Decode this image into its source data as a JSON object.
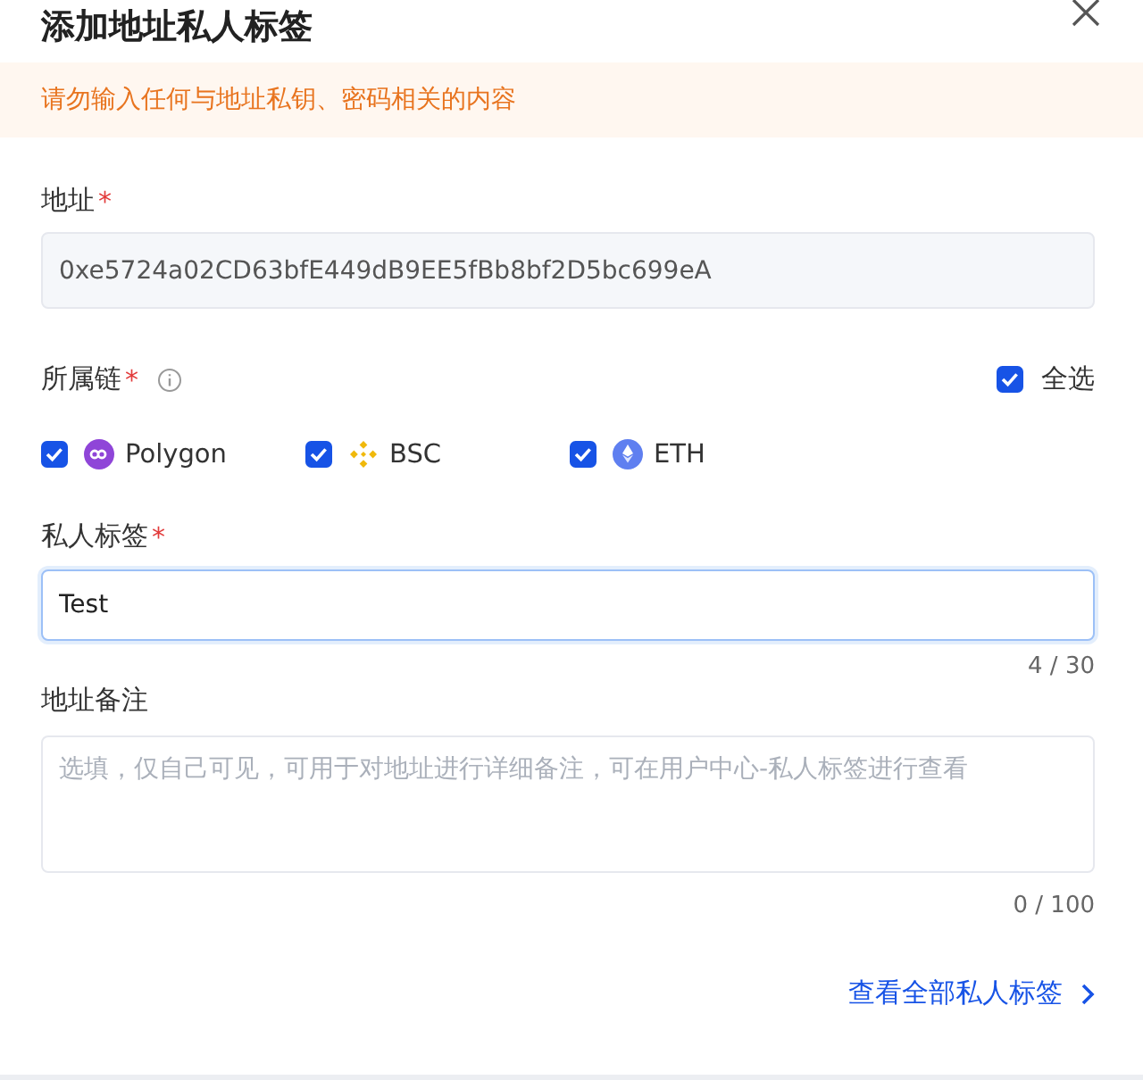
{
  "dialog": {
    "title": "添加地址私人标签"
  },
  "warning": "请勿输入任何与地址私钥、密码相关的内容",
  "address": {
    "label": "地址",
    "required_mark": "*",
    "value": "0xe5724a02CD63bfE449dB9EE5fBb8bf2D5bc699eA"
  },
  "chains": {
    "label": "所属链",
    "required_mark": "*",
    "select_all": {
      "label": "全选",
      "checked": true
    },
    "items": [
      {
        "name": "Polygon",
        "kind": "polygon",
        "checked": true
      },
      {
        "name": "BSC",
        "kind": "bsc",
        "checked": true
      },
      {
        "name": "ETH",
        "kind": "eth",
        "checked": true
      }
    ]
  },
  "tag": {
    "label": "私人标签",
    "required_mark": "*",
    "value": "Test",
    "counter": "4 / 30"
  },
  "note": {
    "label": "地址备注",
    "placeholder": "选填，仅自己可见，可用于对地址进行详细备注，可在用户中心-私人标签进行查看",
    "counter": "0 / 100"
  },
  "link": "查看全部私人标签"
}
